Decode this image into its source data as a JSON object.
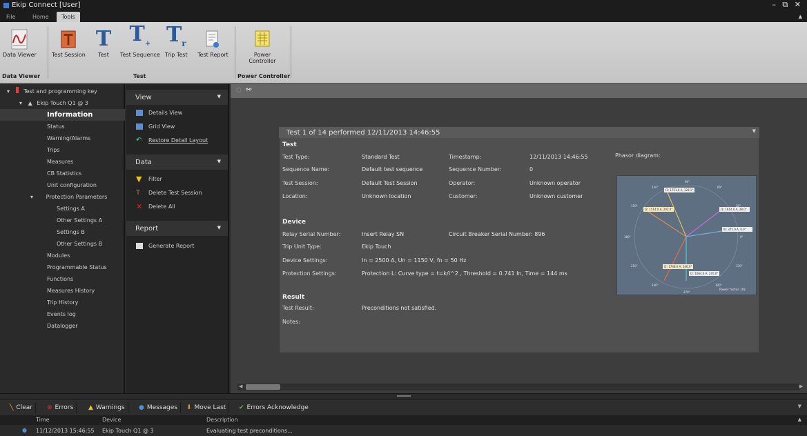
{
  "window": {
    "title": "Ekip Connect [User]",
    "controls": "– ⧉ ✕"
  },
  "ribbon_tabs": [
    "File",
    "Home",
    "Tools"
  ],
  "ribbon": {
    "buttons": [
      "Data Viewer",
      "Test Session",
      "Test",
      "Test Sequence",
      "Trip Test",
      "Test Report",
      "Power Controller"
    ],
    "groups": [
      "Data Viewer",
      "Test",
      "Power Controller"
    ]
  },
  "tree": {
    "root": "Test and programming key",
    "device": "Ekip Touch Q1 @ 3",
    "items": [
      "Information",
      "Status",
      "Warning/Alarms",
      "Trips",
      "Measures",
      "CB Statistics",
      "Unit configuration",
      "Protection Parameters",
      "Settings A",
      "Other Settings A",
      "Settings B",
      "Other Settings B",
      "Modules",
      "Programmable Status",
      "Functions",
      "Measures History",
      "Trip History",
      "Events log",
      "Datalogger"
    ]
  },
  "mid": {
    "view_title": "View",
    "view_items": [
      "Details View",
      "Grid View",
      "Restore Detail Layout"
    ],
    "data_title": "Data",
    "data_items": [
      "Filter",
      "Delete Test Session",
      "Delete All"
    ],
    "report_title": "Report",
    "report_items": [
      "Generate Report"
    ]
  },
  "card": {
    "header": "Test 1 of 14 performed 12/11/2013 14:46:55",
    "test_section": "Test",
    "test_type_label": "Test Type:",
    "test_type": "Standard Test",
    "timestamp_label": "Timestamp:",
    "timestamp": "12/11/2013 14:46:55",
    "seq_name_label": "Sequence Name:",
    "seq_name": "Default test sequence",
    "seq_number_label": "Sequence Number:",
    "seq_number": "0",
    "session_label": "Test Session:",
    "session": "Default Test Session",
    "operator_label": "Operator:",
    "operator": "Unknown operator",
    "location_label": "Location:",
    "location": "Unknown location",
    "customer_label": "Customer:",
    "customer": "Unknown customer",
    "phasor_label": "Phasor diagram:",
    "device_section": "Device",
    "relay_sn_label": "Relay Serial Number:",
    "relay_sn": "Insert Relay SN",
    "cb_sn": "Circuit Breaker Serial Number: 896",
    "trip_unit_label": "Trip Unit Type:",
    "trip_unit": "Ekip Touch",
    "dev_settings_label": "Device Settings:",
    "dev_settings": "In = 2500 A, Un = 1150 V, fn = 50 Hz",
    "prot_settings_label": "Protection Settings:",
    "prot_settings": "Protection L: Curve type = t=k/I^2 , Threshold = 0.741 In, Time = 144 ms",
    "result_section": "Result",
    "test_result_label": "Test Result:",
    "test_result": "Preconditions not satisfied.",
    "notes_label": "Notes:"
  },
  "phasor": {
    "angles": [
      "90°",
      "120°",
      "60°",
      "150°",
      "30°",
      "180°",
      "0°",
      "210°",
      "330°",
      "240°",
      "300°",
      "270°"
    ],
    "vectors": [
      "I3: 1751.0 A, 128.1°",
      "I2: 1514.0 A, 202.0°",
      "I1: 1614.0 A, 28.0°",
      "Ib: 375.0 A, 0.0°",
      "I1: 1748.0 A, 246.0°",
      "I2: 1664.0 A, 270.0°"
    ],
    "footer": "Power factor: [0]"
  },
  "bottom_toolbar": [
    "Clear",
    "Errors",
    "Warnings",
    "Messages",
    "Move Last",
    "Errors Acknowledge"
  ],
  "log": {
    "columns": [
      "Time",
      "Device",
      "Description"
    ],
    "row": {
      "time": "11/12/2013 15:46:55",
      "device": "Ekip Touch Q1 @ 3",
      "description": "Evaluating test preconditions..."
    }
  }
}
